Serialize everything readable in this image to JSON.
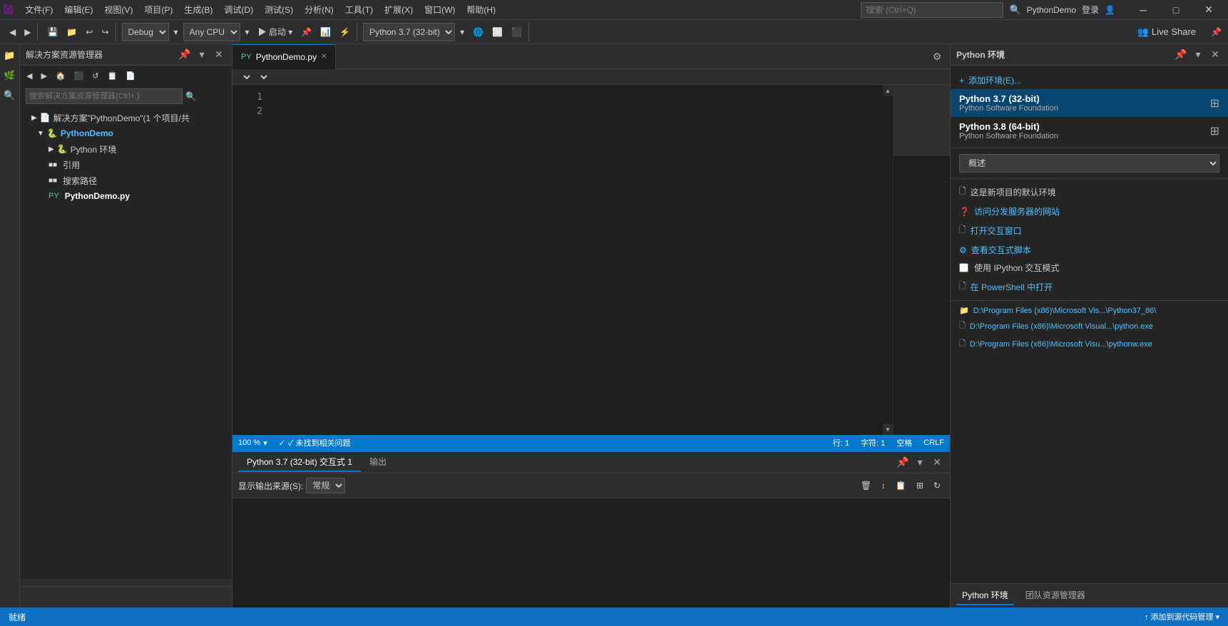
{
  "app": {
    "logo": "✕",
    "title": "PythonDemo"
  },
  "menu": {
    "items": [
      {
        "label": "文件(F)"
      },
      {
        "label": "编辑(E)"
      },
      {
        "label": "视图(V)"
      },
      {
        "label": "项目(P)"
      },
      {
        "label": "生成(B)"
      },
      {
        "label": "调试(D)"
      },
      {
        "label": "测试(S)"
      },
      {
        "label": "分析(N)"
      },
      {
        "label": "工具(T)"
      },
      {
        "label": "扩展(X)"
      },
      {
        "label": "窗口(W)"
      },
      {
        "label": "帮助(H)"
      }
    ],
    "search_placeholder": "搜索 (Ctrl+Q)",
    "user": "PythonDemo",
    "login": "登录"
  },
  "toolbar": {
    "undo": "↩",
    "redo": "↪",
    "save_icon": "💾",
    "debug_config": "Debug",
    "platform": "Any CPU",
    "start_label": "▶ 启动 ▾",
    "python_version": "Python 3.7 (32-bit)",
    "live_share_label": "Live Share"
  },
  "sidebar": {
    "title": "解决方案资源管理器",
    "search_placeholder": "搜索解决方案资源管理器(Ctrl+;)",
    "tree": {
      "solution_label": "解决方案\"PythonDemo\"(1 个项目/共",
      "project_label": "PythonDemo",
      "python_env_label": "Python 环境",
      "references_label": "引用",
      "search_paths_label": "搜索路径",
      "file_label": "PythonDemo.py"
    }
  },
  "editor": {
    "tab_label": "PythonDemo.py",
    "tab_modified": false,
    "line_numbers": [
      "1",
      "2"
    ],
    "nav_dropdown1": "",
    "nav_dropdown2": ""
  },
  "status_bar": {
    "no_issues": "✓ 未找到相关问题",
    "zoom": "100 %",
    "row": "行: 1",
    "col": "字符: 1",
    "spaces": "空格",
    "line_ending": "CRLF",
    "encoding": ""
  },
  "output_panel": {
    "title": "输出",
    "source_label": "显示输出来源(S):",
    "source_value": "常规",
    "tabs": [
      {
        "label": "Python 3.7 (32-bit) 交互式 1",
        "active": true
      },
      {
        "label": "输出",
        "active": false
      }
    ]
  },
  "python_env_panel": {
    "title": "Python 环境",
    "add_env_label": "添加环境(E)...",
    "environments": [
      {
        "name": "Python 3.7 (32-bit)",
        "desc": "Python Software Foundation",
        "selected": true
      },
      {
        "name": "Python 3.8 (64-bit)",
        "desc": "Python Software Foundation",
        "selected": false
      }
    ],
    "section_label": "概述",
    "section_dropdown_value": "概述",
    "actions": [
      {
        "icon": "🗋",
        "label": "这是新项目的默认环境",
        "type": "info"
      },
      {
        "icon": "?",
        "label": "访问分发服务器的网站",
        "type": "link"
      },
      {
        "icon": "🗋",
        "label": "打开交互窗口",
        "type": "link"
      },
      {
        "icon": "⚙",
        "label": "查看交互式脚本",
        "type": "link"
      },
      {
        "label": "使用 IPython 交互模式",
        "type": "checkbox"
      },
      {
        "icon": "🗋",
        "label": "在 PowerShell 中打开",
        "type": "link"
      }
    ],
    "file_paths": [
      "D:\\Program Files (x86)\\Microsoft Vis...\\Python37_86\\",
      "D:\\Program Files (x86)\\Microsoft Visual...\\python.exe",
      "D:\\Program Files (x86)\\Microsoft Visu...\\pythonw.exe"
    ],
    "footer_tabs": [
      {
        "label": "Python 环境",
        "active": true
      },
      {
        "label": "团队资源管理器",
        "active": false
      }
    ]
  },
  "bottom_status": {
    "left": "就绪",
    "right": "↑ 添加到源代码管理 ▾"
  }
}
